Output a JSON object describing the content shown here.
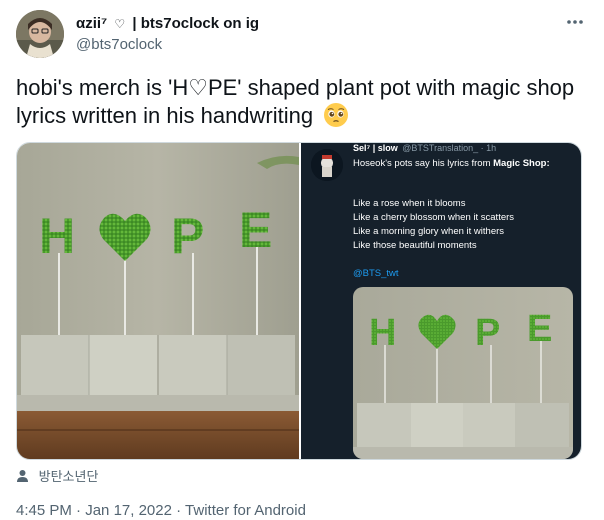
{
  "author": {
    "display_name": "αzii⁷",
    "heart_glyph": "♡",
    "separator": "|",
    "bio_name": "bts7oclock on ig",
    "handle": "@bts7oclock"
  },
  "more_icon": "more-dots-icon",
  "tweet": {
    "text": "hobi's merch is 'H♡PE' shaped plant pot with  magic shop lyrics written in his handwriting",
    "emoji": "pleading-face-emoji"
  },
  "media": {
    "left_photo": {
      "letters": [
        "H",
        "♥",
        "P",
        "E"
      ]
    },
    "right_screenshot": {
      "name": "Sel⁷ | slow",
      "handle": "@BTSTranslation_ · 1h",
      "intro": "Hoseok's pots say his lyrics from ",
      "intro_bold": "Magic Shop",
      "intro_end": ":",
      "lines": [
        "Like a rose when it blooms",
        "Like a cherry blossom when it scatters",
        "Like a morning glory when it withers",
        "Like those beautiful moments"
      ],
      "tag": "@BTS_twt"
    }
  },
  "tagged": {
    "icon": "person-icon",
    "label": "방탄소년단"
  },
  "meta": {
    "time": "4:45 PM",
    "date": "Jan 17, 2022",
    "source": "Twitter for Android",
    "dot": "·"
  },
  "colors": {
    "text": "#0f1419",
    "secondary": "#536471",
    "link": "#1d9bf0",
    "dark_bg": "#15202b",
    "moss": "#4a9a2c"
  }
}
